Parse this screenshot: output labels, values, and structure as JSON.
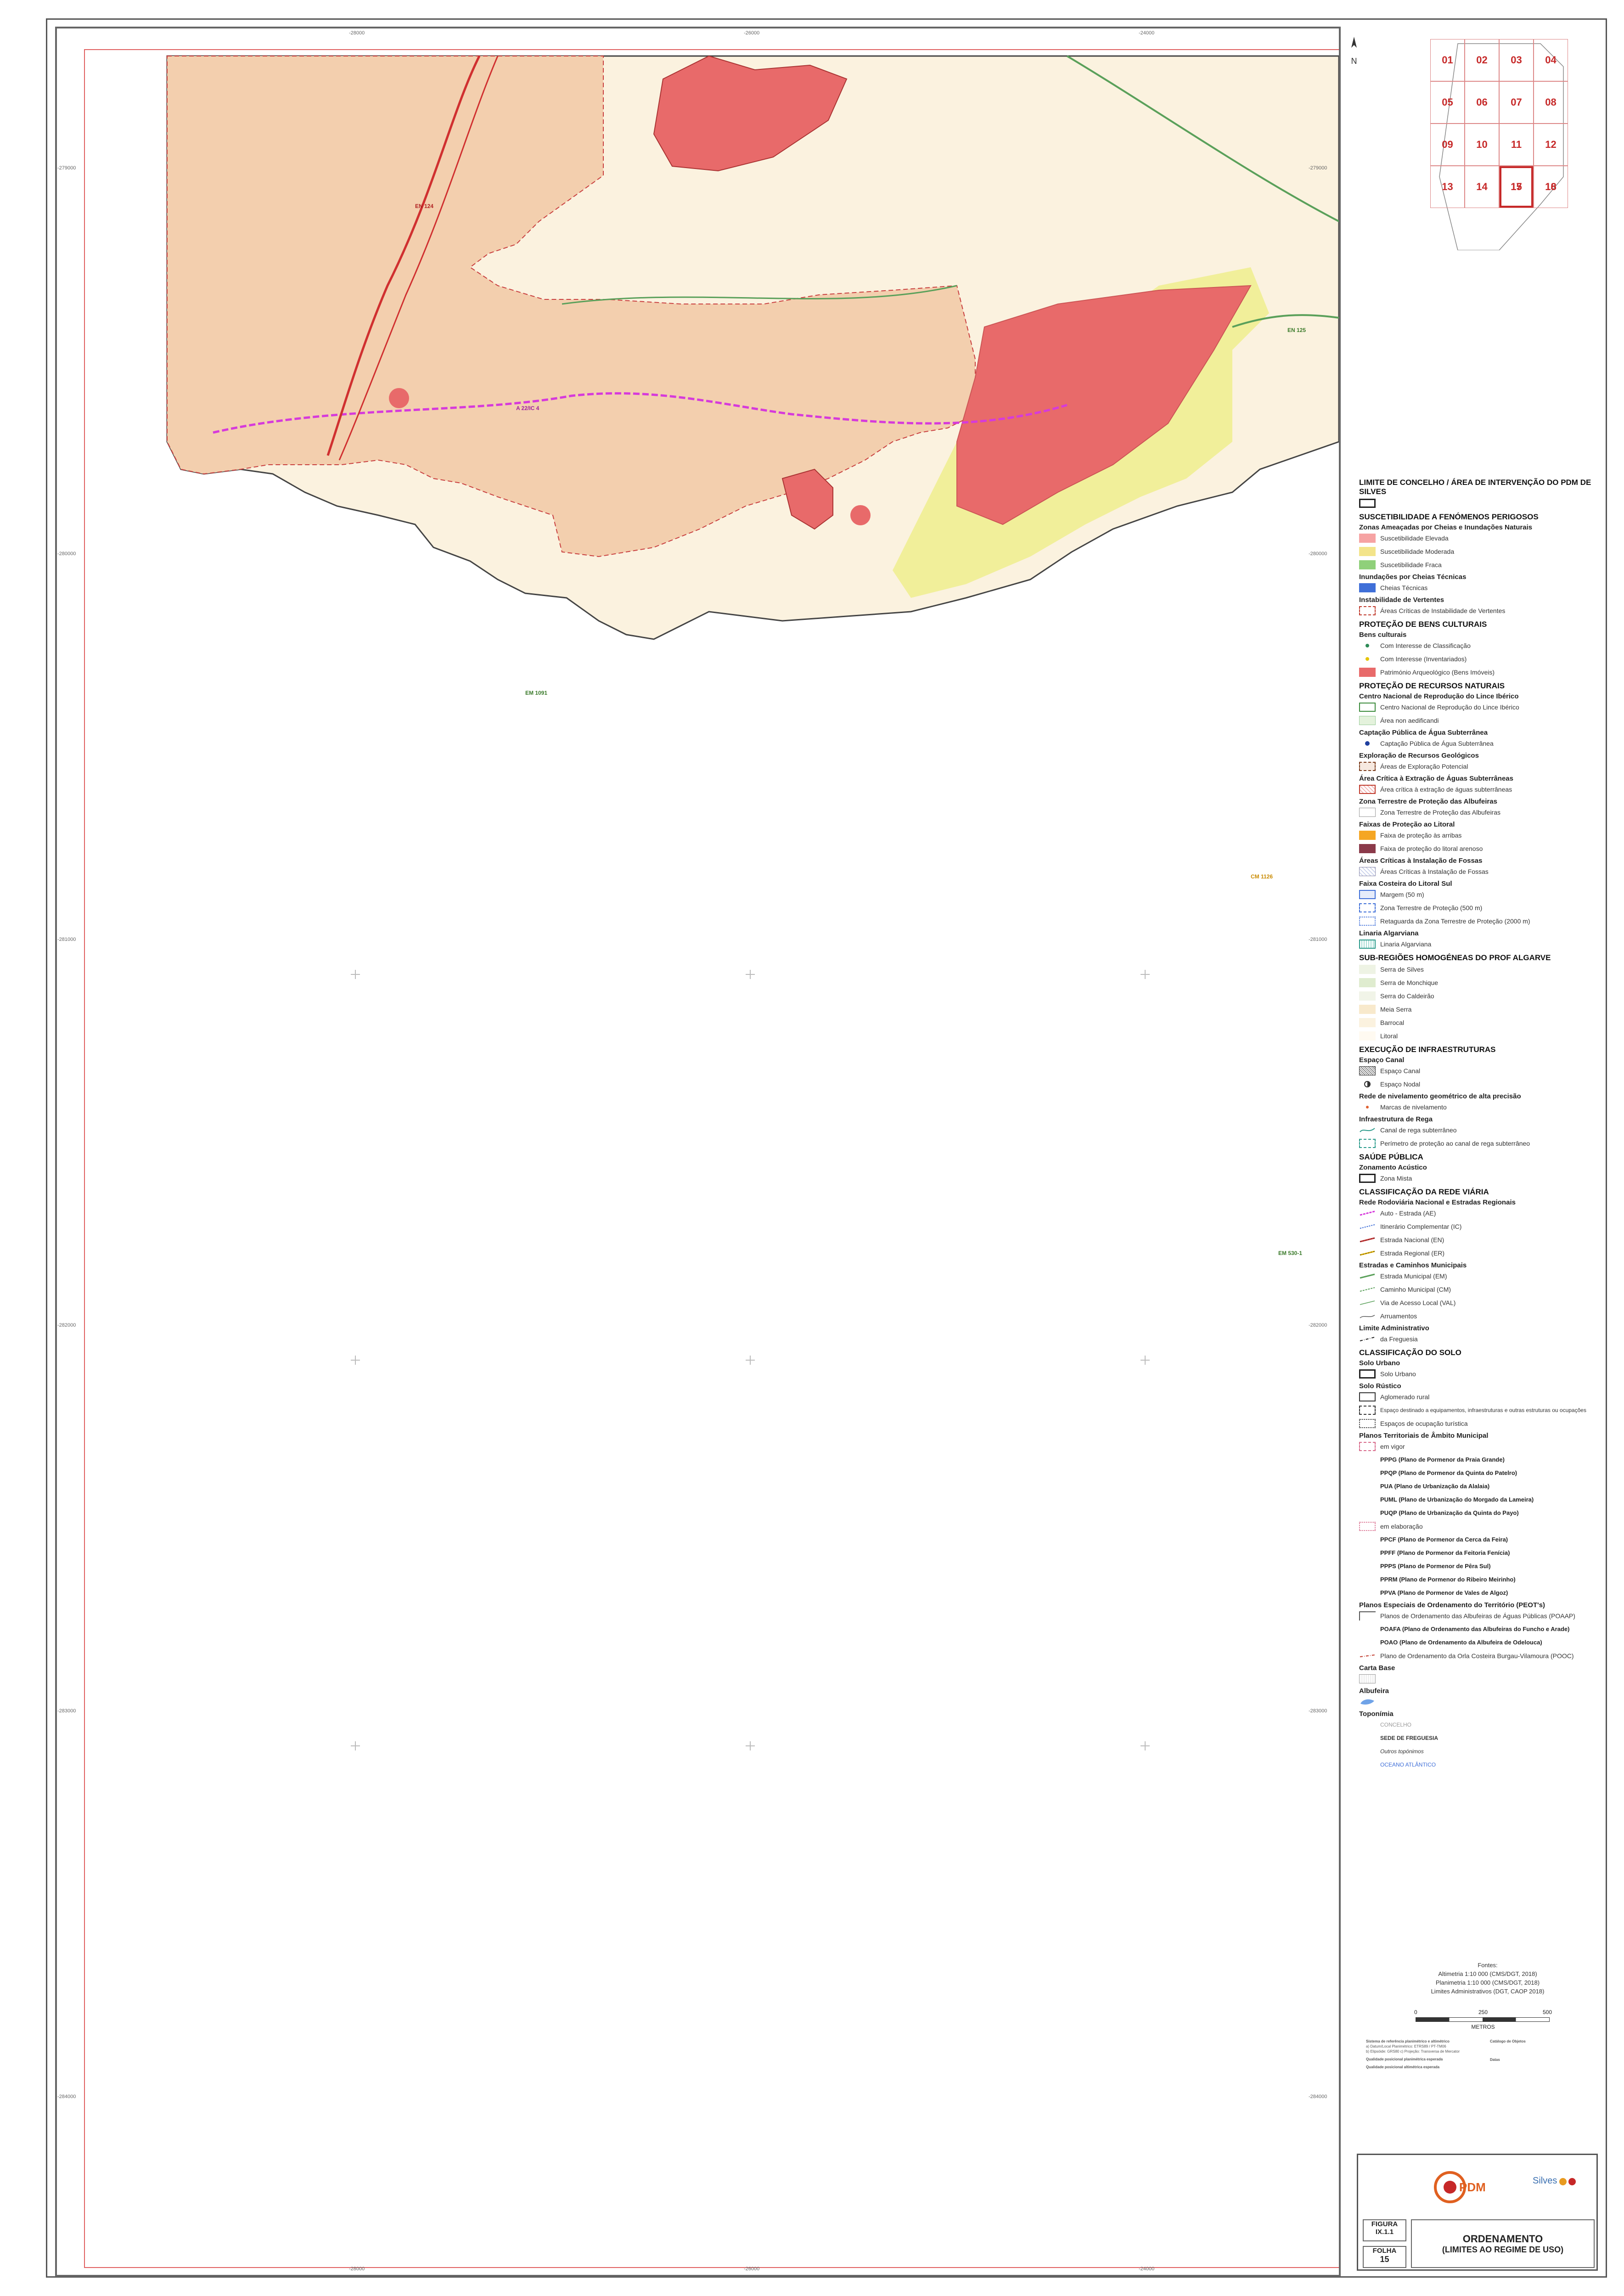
{
  "coords": {
    "top": [
      "-28000",
      "-26000",
      "-24000"
    ],
    "bottom": [
      "-28000",
      "-26000",
      "-24000"
    ],
    "left": [
      "-279000",
      "-280000",
      "-281000",
      "-282000",
      "-283000",
      "-284000",
      "-285000"
    ],
    "right": [
      "-279000",
      "-280000",
      "-281000",
      "-282000",
      "-283000",
      "-284000",
      "-285000"
    ]
  },
  "map_labels": {
    "road_a22": "A 22/IC 4",
    "road_en124": "EN 124",
    "road_em": "EM 1091",
    "road_cm": "CM 1126",
    "road_en125": "EN 125",
    "road_1": "EM 530-1"
  },
  "north": "N",
  "index_grid": {
    "sheets": [
      "01",
      "02",
      "03",
      "04",
      "05",
      "06",
      "07",
      "08",
      "09",
      "10",
      "11",
      "12",
      "13",
      "14",
      "15",
      "16",
      "17",
      "18"
    ],
    "active": "15"
  },
  "legend": {
    "limit_title": "LIMITE DE CONCELHO / ÁREA DE INTERVENÇÃO DO PDM DE SILVES",
    "hazard_title": "SUSCETIBILIDADE A FENÓMENOS PERIGOSOS",
    "flood_title": "Zonas Ameaçadas por Cheias e Inundações Naturais",
    "flood_high": "Suscetibilidade Elevada",
    "flood_mod": "Suscetibilidade Moderada",
    "flood_low": "Suscetibilidade Fraca",
    "tech_title": "Inundações por Cheias Técnicas",
    "tech_item": "Cheias Técnicas",
    "slope_title": "Instabilidade de Vertentes",
    "slope_item": "Áreas Críticas de Instabilidade de Vertentes",
    "heritage_title": "PROTEÇÃO DE BENS CULTURAIS",
    "heritage_sub": "Bens culturais",
    "heritage_1": "Com Interesse de Classificação",
    "heritage_2": "Com Interesse (Inventariados)",
    "heritage_3": "Património Arqueológico (Bens Imóveis)",
    "natural_title": "PROTEÇÃO DE RECURSOS NATURAIS",
    "lynx_title": "Centro Nacional de Reprodução do Lince Ibérico",
    "lynx_1": "Centro Nacional de Reprodução do Lince Ibérico",
    "lynx_2": "Área non aedificandi",
    "capt_title": "Captação Pública de Água Subterrânea",
    "capt_item": "Captação Pública de Água Subterrânea",
    "geo_title": "Exploração de Recursos Geológicos",
    "geo_item": "Áreas de Exploração Potencial",
    "crit_title": "Área Crítica à Extração de Águas Subterrâneas",
    "crit_item": "Área crítica à extração de águas subterrâneas",
    "reserv_title": "Zona Terrestre de Proteção das Albufeiras",
    "reserv_item": "Zona Terrestre de Proteção das Albufeiras",
    "coast_title": "Faixas de Proteção ao Litoral",
    "coast_1": "Faixa de proteção às arribas",
    "coast_2": "Faixa de proteção do litoral arenoso",
    "pits_title": "Áreas Críticas à Instalação de Fossas",
    "pits_item": "Áreas Críticas à Instalação de Fossas",
    "south_title": "Faixa Costeira do Litoral Sul",
    "south_1": "Margem (50 m)",
    "south_2": "Zona Terrestre de Proteção (500 m)",
    "south_3": "Retaguarda da Zona Terrestre de Proteção (2000 m)",
    "lin_title": "Linaria Algarviana",
    "lin_item": "Linaria Algarviana",
    "prof_title": "SUB-REGIÕES HOMOGÉNEAS DO PROF ALGARVE",
    "prof_1": "Serra de Silves",
    "prof_2": "Serra de Monchique",
    "prof_3": "Serra do Caldeirão",
    "prof_4": "Meia Serra",
    "prof_5": "Barrocal",
    "prof_6": "Litoral",
    "infra_title": "EXECUÇÃO DE INFRAESTRUTURAS",
    "channel_title": "Espaço Canal",
    "channel_1": "Espaço Canal",
    "channel_2": "Espaço Nodal",
    "level_title": "Rede de nivelamento geométrico de alta precisão",
    "level_item": "Marcas de nivelamento",
    "irr_title": "Infraestrutura de Rega",
    "irr_1": "Canal de rega subterrâneo",
    "irr_2": "Perímetro de proteção ao canal de rega subterrâneo",
    "health_title": "SAÚDE PÚBLICA",
    "acoustic_title": "Zonamento Acústico",
    "acoustic_item": "Zona Mista",
    "road_title": "CLASSIFICAÇÃO DA REDE VIÁRIA",
    "rrn_title": "Rede Rodoviária Nacional e Estradas Regionais",
    "rrn_1": "Auto - Estrada (AE)",
    "rrn_2": "Itinerário Complementar (IC)",
    "rrn_3": "Estrada Nacional (EN)",
    "rrn_4": "Estrada Regional (ER)",
    "mun_title": "Estradas e Caminhos Municipais",
    "mun_1": "Estrada Municipal (EM)",
    "mun_2": "Caminho Municipal (CM)",
    "mun_3": "Via de Acesso Local (VAL)",
    "mun_4": "Arruamentos",
    "adm_title": "Limite Administrativo",
    "adm_item": "da Freguesia",
    "soil_title": "CLASSIFICAÇÃO DO SOLO",
    "urban_title": "Solo Urbano",
    "urban_item": "Solo Urbano",
    "rustic_title": "Solo Rústico",
    "rustic_1": "Aglomerado rural",
    "rustic_2": "Espaço destinado a equipamentos, infraestruturas e outras estruturas ou ocupações",
    "rustic_3": "Espaços de ocupação turística",
    "plans_title": "Planos Territoriais de Âmbito Municipal",
    "plans_force": "em vigor",
    "plan_pppg": "PPPG (Plano de Pormenor da Praia Grande)",
    "plan_ppqp": "PPQP (Plano de Pormenor da Quinta do Patelro)",
    "plan_pua": "PUA (Plano de Urbanização da Alalaia)",
    "plan_puml": "PUML (Plano de Urbanização do Morgado da Lameira)",
    "plan_puqp": "PUQP (Plano de Urbanização da Quinta do Payo)",
    "plans_dev": "em elaboração",
    "plan_ppcf": "PPCF (Plano de Pormenor da Cerca da Feira)",
    "plan_ppff": "PPFF (Plano de Pormenor da Feitoria Fenícia)",
    "plan_ppps": "PPPS (Plano de Pormenor de Pêra Sul)",
    "plan_pprm": "PPRM (Plano de Pormenor do Ribeiro Meirinho)",
    "plan_ppva": "PPVA (Plano de Pormenor de Vales de Algoz)",
    "peot_title": "Planos Especiais de Ordenamento do Território (PEOT's)",
    "peot_1": "Planos de Ordenamento das Albufeiras de Águas Públicas (POAAP)",
    "peot_2": "POAFA (Plano de Ordenamento das Albufeiras do Funcho e Arade)",
    "peot_3": "POAO (Plano de Ordenamento da Albufeira de Odelouca)",
    "peot_4": "Plano de Ordenamento da Orla Costeira Burgau-Vilamoura (POOC)",
    "base_title": "Carta Base",
    "albu_title": "Albufeira",
    "topo_title": "Toponímia",
    "topo_1": "CONCELHO",
    "topo_2": "SEDE DE FREGUESIA",
    "topo_3": "Outros topónimos",
    "topo_4": "OCEANO ATLÂNTICO"
  },
  "sources": {
    "title": "Fontes:",
    "l1": "Altimetria 1:10 000 (CMS/DGT, 2018)",
    "l2": "Planimetria 1:10 000 (CMS/DGT, 2018)",
    "l3": "Limites Administrativos (DGT, CAOP 2018)"
  },
  "scale": {
    "t0": "0",
    "t1": "250",
    "t2": "500",
    "unit": "METROS"
  },
  "ref_notes": {
    "a": "Sistema de referência planimétrico e altimétrico",
    "b": "a) Datum/Local Planimétrico: ETRS89 / PT-TM06",
    "c": "b) Elipsóide: GRS80   c) Projeção: Transversa de Mercator",
    "d": "Qualidade posicional planimétrica esperada",
    "e": "Qualidade posicional altimétrica esperada",
    "f": "Catálogo de Objetos",
    "g": "Datas"
  },
  "title_block": {
    "fig_label": "FIGURA",
    "fig_num": "IX.1.1",
    "sheet_label": "FOLHA",
    "sheet_num": "15",
    "title": "ORDENAMENTO",
    "subtitle": "(LIMITES AO REGIME DE USO)",
    "logo": "PDM",
    "logo2": "Silves"
  },
  "colors": {
    "urban_fill": "#f3cfae",
    "barrocal": "#fbf2df",
    "hazard_high": "#e86a6a",
    "hazard_low_yellow": "#f1ef9a",
    "accent_red": "#c62828"
  }
}
